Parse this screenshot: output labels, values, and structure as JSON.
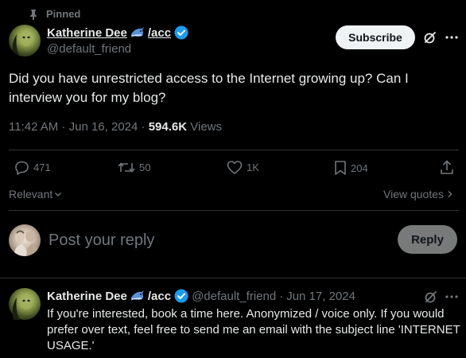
{
  "pinned": {
    "label": "Pinned"
  },
  "author": {
    "name": "Katherine Dee",
    "name_suffix": "/acc",
    "handle": "@default_friend"
  },
  "header": {
    "subscribe_label": "Subscribe"
  },
  "tweet": {
    "text": "Did you have unrestricted access to the Internet growing up? Can I interview you for my blog?",
    "time": "11:42 AM",
    "date": "Jun 16, 2024",
    "views_count": "594.6K",
    "views_label": "Views"
  },
  "stats": {
    "replies": "471",
    "reposts": "50",
    "likes": "1K",
    "bookmarks": "204"
  },
  "sort": {
    "relevant_label": "Relevant",
    "view_quotes_label": "View quotes"
  },
  "composer": {
    "placeholder": "Post your reply",
    "reply_label": "Reply"
  },
  "reply_tweet": {
    "name": "Katherine Dee",
    "name_suffix": "/acc",
    "handle": "@default_friend",
    "date": "Jun 17, 2024",
    "text": "If you're interested, book a time here. Anonymized / voice only. If you would prefer over text, feel free to send me an email with the subject line 'INTERNET USAGE.'"
  },
  "colors": {
    "background": "#000000",
    "text": "#e7e9ea",
    "muted": "#71767b",
    "verified": "#1d9bf0",
    "divider": "#2f3336"
  },
  "icons": [
    "pin-icon",
    "shark-emoji-icon",
    "verified-badge-icon",
    "grok-icon",
    "more-icon",
    "reply-icon",
    "repost-icon",
    "like-icon",
    "bookmark-icon",
    "share-icon",
    "chevron-down-icon",
    "chevron-right-icon"
  ]
}
